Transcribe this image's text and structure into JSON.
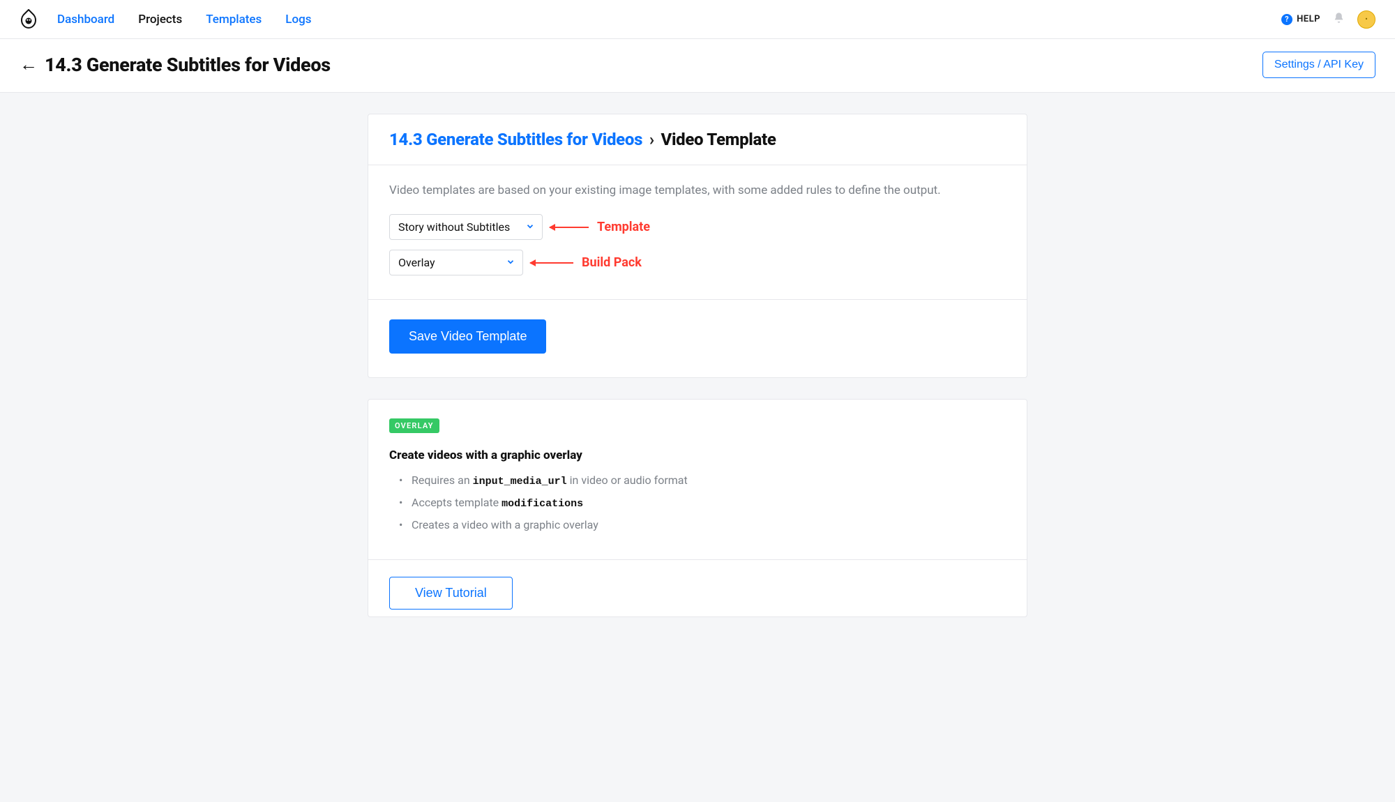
{
  "nav": {
    "dashboard": "Dashboard",
    "projects": "Projects",
    "templates": "Templates",
    "logs": "Logs",
    "help": "HELP",
    "avatar_initial": "•"
  },
  "header": {
    "title": "14.3 Generate Subtitles for Videos",
    "settings_btn": "Settings / API Key"
  },
  "breadcrumb": {
    "link": "14.3 Generate Subtitles for Videos",
    "sep": "›",
    "current": "Video Template"
  },
  "form": {
    "description": "Video templates are based on your existing image templates, with some added rules to define the output.",
    "template_value": "Story without Subtitles",
    "buildpack_value": "Overlay",
    "save_btn": "Save Video Template"
  },
  "annotations": {
    "template": "Template",
    "buildpack": "Build Pack"
  },
  "overlay_card": {
    "badge": "OVERLAY",
    "title": "Create videos with a graphic overlay",
    "bullet1_pre": "Requires an ",
    "bullet1_code": "input_media_url",
    "bullet1_post": " in video or audio format",
    "bullet2_pre": "Accepts template ",
    "bullet2_code": "modifications",
    "bullet3": "Creates a video with a graphic overlay",
    "tutorial_btn": "View Tutorial"
  }
}
